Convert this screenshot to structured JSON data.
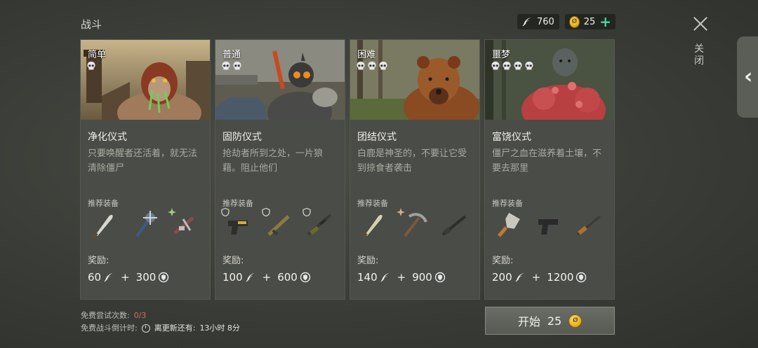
{
  "header": {
    "title": "战斗",
    "feathers": "760",
    "coins": "25",
    "close_label": "关闭"
  },
  "cards": [
    {
      "difficulty": "简单",
      "skulls": 1,
      "name": "净化仪式",
      "desc": "只要唤醒者还活着，就无法清除僵尸",
      "rec_label": "推荐装备",
      "gear": [
        "machete",
        "spiked-mace",
        "crossbow"
      ],
      "reward_label": "奖励:",
      "reward_feathers": "60",
      "reward_points": "300"
    },
    {
      "difficulty": "普通",
      "skulls": 2,
      "name": "固防仪式",
      "desc": "抢劫者所到之处，一片狼藉。阻止他们",
      "rec_label": "推荐装备",
      "gear": [
        "pistol",
        "rifle",
        "sniper-rifle"
      ],
      "reward_label": "奖励:",
      "reward_feathers": "100",
      "reward_points": "600"
    },
    {
      "difficulty": "困难",
      "skulls": 3,
      "name": "团结仪式",
      "desc": "白鹿是神圣的，不要让它受到掠食者袭击",
      "rec_label": "推荐装备",
      "gear": [
        "machete",
        "pickaxe",
        "shotgun"
      ],
      "reward_label": "奖励:",
      "reward_feathers": "140",
      "reward_points": "900"
    },
    {
      "difficulty": "噩梦",
      "skulls": 4,
      "name": "富饶仪式",
      "desc": "僵尸之血在滋养着土壤，不要去那里",
      "rec_label": "推荐装备",
      "gear": [
        "cleaver",
        "pistol",
        "hunting-rifle"
      ],
      "reward_label": "奖励:",
      "reward_feathers": "200",
      "reward_points": "1200"
    }
  ],
  "footer": {
    "free_tries_label": "免费尝试次数:",
    "free_tries_value": "0/3",
    "countdown_label": "免费战斗倒计时:",
    "refresh_label": "离更新还有:",
    "refresh_value": "13小时 8分",
    "start_label": "开始",
    "start_cost": "25"
  },
  "colors": {
    "accent_plus": "#4fd1a5",
    "coin": "#e0a915",
    "tries_red": "#d86b66"
  }
}
